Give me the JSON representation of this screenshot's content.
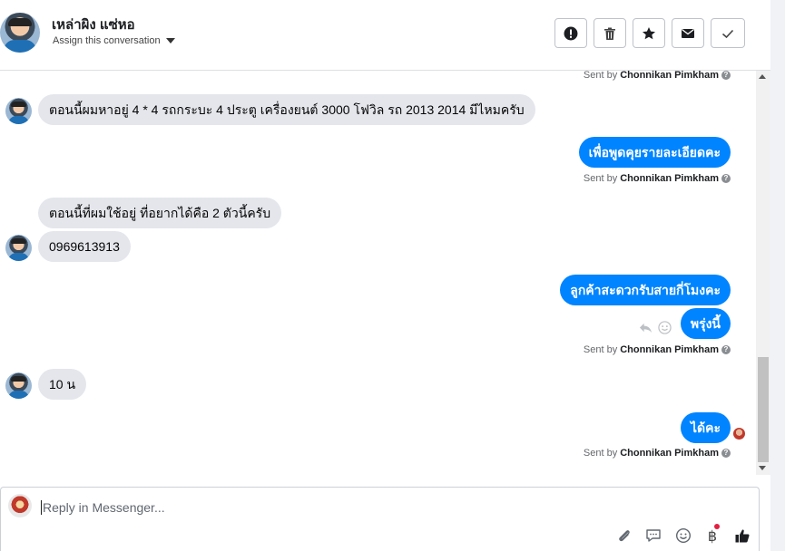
{
  "header": {
    "contact_name": "เหล่าผิง แซ่หอ",
    "assign_label": "Assign this conversation",
    "actions": [
      {
        "name": "mark-spam-button",
        "icon": "exclamation-icon"
      },
      {
        "name": "delete-button",
        "icon": "trash-icon"
      },
      {
        "name": "star-button",
        "icon": "star-icon"
      },
      {
        "name": "mark-unread-button",
        "icon": "envelope-icon"
      },
      {
        "name": "mark-done-button",
        "icon": "check-icon"
      }
    ]
  },
  "sent_by_prefix": "Sent by",
  "agent_name": "Chonnikan Pimkham",
  "help_glyph": "?",
  "messages": [
    {
      "side": "in",
      "text": "ตอนนี้ผมหาอยู่ 4 * 4 รถกระบะ 4 ประตู เครื่องยนต์ 3000 โฟวิล รถ 2013 2014 มีไหมครับ"
    },
    {
      "side": "out",
      "text": "เพื่อพูดคุยรายละเอียดคะ"
    },
    {
      "side": "in",
      "text": "ตอนนี้ที่ผมใช้อยู่ ที่อยากได้คือ 2 ตัวนี้ครับ"
    },
    {
      "side": "in",
      "text": "0969613913"
    },
    {
      "side": "out",
      "text": "ลูกค้าสะดวกรับสายกี่โมงคะ"
    },
    {
      "side": "out",
      "text": "พรุ่งนี้"
    },
    {
      "side": "in",
      "text": "10 น"
    },
    {
      "side": "out",
      "text": "ได้คะ"
    }
  ],
  "composer": {
    "placeholder": "Reply in Messenger...",
    "baht_glyph": "฿",
    "tools": [
      "paperclip-icon",
      "chat-bubble-icon",
      "emoji-icon",
      "baht-icon",
      "thumbs-up-icon"
    ]
  },
  "colors": {
    "outgoing_bubble": "#0084ff",
    "incoming_bubble": "#e4e6eb"
  }
}
